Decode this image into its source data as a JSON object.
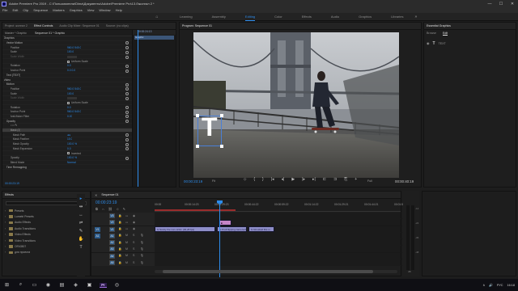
{
  "app": {
    "title": "Adobe Premiere Pro 2019 - C:\\Пользователи\\Dima\\Документы\\Adobe\\Premiere Pro\\13.0\\жонгал 2 *",
    "window_controls": [
      "—",
      "☐",
      "✕"
    ]
  },
  "menu": [
    "File",
    "Edit",
    "Clip",
    "Sequence",
    "Markers",
    "Graphics",
    "View",
    "Window",
    "Help"
  ],
  "workspaces": {
    "tabs": [
      "Learning",
      "Assembly",
      "Editing",
      "Color",
      "Effects",
      "Audio",
      "Graphics",
      "Libraries"
    ],
    "active": "Editing",
    "more": "»"
  },
  "effect_controls": {
    "tabs": [
      "Project: жонгал 2",
      "Effect Controls",
      "Audio Clip Mixer: Sequence 01",
      "Source: (no clips)"
    ],
    "active_tab": "Effect Controls",
    "header": [
      "Master * Graphic",
      "Sequence 01 * Graphic"
    ],
    "mini_timeline_time": "00:00:24:13",
    "mini_clip_label": "Graphic",
    "rows": [
      {
        "name": "Graphics",
        "indent": 1,
        "kind": "section"
      },
      {
        "name": "Vector Motion",
        "indent": 3,
        "kind": "section",
        "kf": true
      },
      {
        "name": "Position",
        "indent": 6,
        "value": "960.0   540.0",
        "kf": true
      },
      {
        "name": "Scale",
        "indent": 6,
        "value": "100.0",
        "kf": true
      },
      {
        "name": "Scale Width",
        "indent": 6,
        "value": "",
        "kf": true,
        "dim": true
      },
      {
        "name": "",
        "indent": 6,
        "check": "Uniform Scale"
      },
      {
        "name": "Rotation",
        "indent": 6,
        "value": "0.0",
        "kf": true
      },
      {
        "name": "Anchor Point",
        "indent": 6,
        "value": "0.0   0.0",
        "kf": true
      },
      {
        "name": "Text (TEXT)",
        "indent": 3,
        "kind": "section"
      },
      {
        "name": "Video",
        "indent": 1,
        "kind": "section"
      },
      {
        "name": "Motion",
        "indent": 3,
        "kind": "section",
        "kf": true
      },
      {
        "name": "Position",
        "indent": 6,
        "value": "960.0   540.0",
        "kf": true
      },
      {
        "name": "Scale",
        "indent": 6,
        "value": "100.0",
        "kf": true
      },
      {
        "name": "Scale Width",
        "indent": 6,
        "value": "",
        "kf": true,
        "dim": true
      },
      {
        "name": "",
        "indent": 6,
        "check": "Uniform Scale"
      },
      {
        "name": "Rotation",
        "indent": 6,
        "value": "0.0",
        "kf": true
      },
      {
        "name": "Anchor Point",
        "indent": 6,
        "value": "960.0   540.0",
        "kf": true
      },
      {
        "name": "Anti-flicker Filter",
        "indent": 6,
        "value": "0.00",
        "kf": true
      },
      {
        "name": "Opacity",
        "indent": 3,
        "kind": "section",
        "kf": true
      },
      {
        "name": "",
        "indent": 6,
        "shapes": "○ □ ✎"
      },
      {
        "name": "Mask (1)",
        "indent": 6,
        "sel": true
      },
      {
        "name": "Mask Path",
        "indent": 8,
        "value": "◂ ▸",
        "kf": true
      },
      {
        "name": "Mask Feather",
        "indent": 8,
        "value": "10.0",
        "kf": true
      },
      {
        "name": "Mask Opacity",
        "indent": 8,
        "value": "100.0 %",
        "kf": true
      },
      {
        "name": "Mask Expansion",
        "indent": 8,
        "value": "0.0",
        "kf": true
      },
      {
        "name": "",
        "indent": 8,
        "check": "Inverted"
      },
      {
        "name": "Opacity",
        "indent": 6,
        "value": "100.0 %",
        "kf": true
      },
      {
        "name": "Blend Mode",
        "indent": 6,
        "value": "Normal"
      },
      {
        "name": "Time Remapping",
        "indent": 3,
        "kind": "section"
      }
    ],
    "footer_time": "00:00:23:19"
  },
  "program": {
    "tab": "Program: Sequence 01",
    "overlay_text": "T",
    "timecode": "00:00:23:19",
    "fit": "Fit",
    "quality": "Full",
    "duration": "00:00:40:19",
    "transport": [
      "⬦",
      "{",
      "}",
      "|◂",
      "◂|",
      "▶",
      "|▸",
      "▸|",
      "⊏",
      "⊐",
      "⎘",
      "+"
    ]
  },
  "essential_graphics": {
    "tab": "Essential Graphics",
    "subtabs": [
      "Browse",
      "Edit"
    ],
    "active_subtab": "Edit",
    "layer_icon": "T",
    "layer_name": "TEXT"
  },
  "effects_panel": {
    "tab": "Effects",
    "items": [
      "Presets",
      "Lumetri Presets",
      "Audio Effects",
      "Audio Transitions",
      "Video Effects",
      "Video Transitions",
      "OFA3507",
      "для проекта"
    ]
  },
  "tools": [
    "▸",
    "⇹",
    "↔",
    "⇌",
    "✎",
    "✋",
    "T"
  ],
  "timeline": {
    "tab": "Sequence 01",
    "timecode": "00:00:23:19",
    "ruler_ticks": [
      "00:00",
      "00:00:14:23",
      "00:00:29:23",
      "00:00:44:22",
      "00:00:59:22",
      "00:01:14:22",
      "00:01:29:21",
      "00:01:44:21",
      "00:01:59:2"
    ],
    "tracks": [
      {
        "id": "V3",
        "type": "video"
      },
      {
        "id": "V2",
        "type": "video",
        "clips": [
          {
            "label": "■",
            "kind": "gfx"
          }
        ]
      },
      {
        "id": "V1",
        "type": "video",
        "src": "V1",
        "clips": [
          {
            "label": "fx  Scotty the non-victim (30,28 fps)",
            "kind": "v"
          },
          {
            "label": "fx  Profi flipping camera fl",
            "kind": "v"
          },
          {
            "label": "fx  Ghosbell flits m",
            "kind": "v"
          }
        ]
      },
      {
        "id": "A1",
        "type": "audio",
        "src": "A1"
      },
      {
        "id": "A2",
        "type": "audio"
      },
      {
        "id": "A3",
        "type": "audio"
      },
      {
        "id": "A4",
        "type": "audio"
      },
      {
        "id": "A5",
        "type": "audio"
      }
    ]
  },
  "meters": {
    "labels": [
      "-12",
      "-24",
      "-36",
      "-48",
      "dB"
    ]
  },
  "taskbar": {
    "items": [
      "⊞",
      "⌕",
      "▭",
      "◉",
      "▤",
      "◈",
      "▣",
      "◎"
    ],
    "premiere_label": "Pr",
    "tray": [
      "∧",
      "🔊",
      "РУС",
      "16:18"
    ]
  },
  "colors": {
    "accent": "#2d8ceb",
    "graphic_clip": "#c584c6",
    "video_clip": "#8e8ec8",
    "selection_box": "#4a7fd6"
  }
}
